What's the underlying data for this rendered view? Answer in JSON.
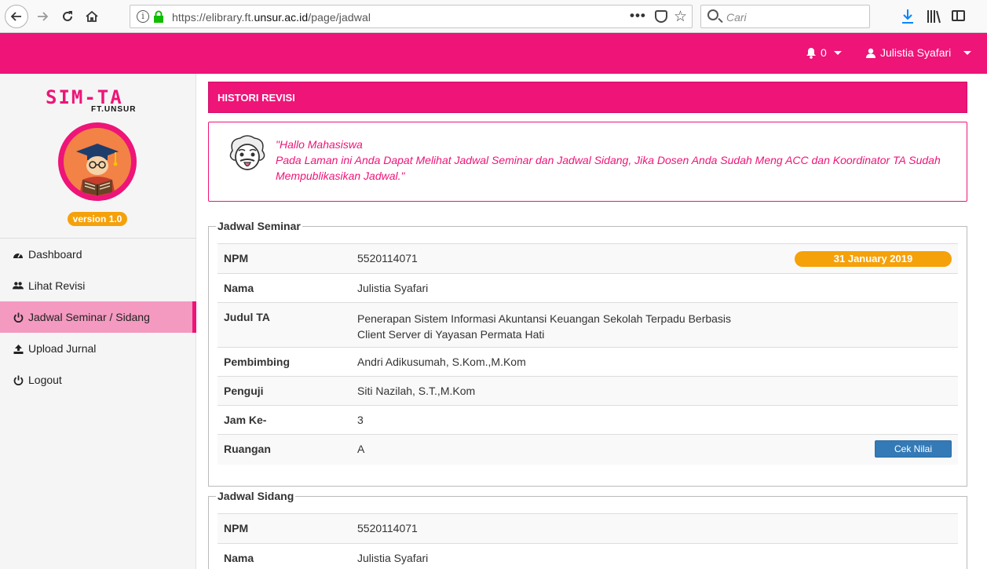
{
  "browser": {
    "url_prefix": "https://elibrary.ft.",
    "url_domain": "unsur.ac.id",
    "url_path": "/page/jadwal",
    "search_placeholder": "Cari",
    "more_label": "•••"
  },
  "header": {
    "notification_count": "0",
    "user_name": "Julistia Syafari"
  },
  "sidebar": {
    "logo_text": "SIM-TA",
    "logo_sub": "FT.UNSUR",
    "version": "version 1.0",
    "items": [
      {
        "label": "Dashboard",
        "icon": "dashboard-icon",
        "active": false
      },
      {
        "label": "Lihat Revisi",
        "icon": "users-icon",
        "active": false
      },
      {
        "label": "Jadwal Seminar / Sidang",
        "icon": "power-icon",
        "active": true
      },
      {
        "label": "Upload Jurnal",
        "icon": "upload-icon",
        "active": false
      },
      {
        "label": "Logout",
        "icon": "power-icon",
        "active": false
      }
    ]
  },
  "main": {
    "panel_title": "HISTORI REVISI",
    "alert_line1": "\"Hallo Mahasiswa",
    "alert_line2": "Pada Laman ini Anda Dapat Melihat Jadwal Seminar dan Jadwal Sidang, Jika Dosen Anda Sudah Meng ACC dan Koordinator TA Sudah Mempublikasikan Jadwal.\"",
    "seminar": {
      "legend": "Jadwal Seminar",
      "date": "31 January 2019",
      "button": "Cek Nilai",
      "rows": [
        {
          "label": "NPM",
          "value": "5520114071"
        },
        {
          "label": "Nama",
          "value": "Julistia Syafari"
        },
        {
          "label": "Judul TA",
          "value": "Penerapan Sistem Informasi Akuntansi Keuangan Sekolah Terpadu Berbasis",
          "value2": "Client Server di Yayasan Permata Hati"
        },
        {
          "label": "Pembimbing",
          "value": "Andri Adikusumah, S.Kom.,M.Kom"
        },
        {
          "label": "Penguji",
          "value": "Siti Nazilah, S.T.,M.Kom"
        },
        {
          "label": "Jam Ke-",
          "value": "3"
        },
        {
          "label": "Ruangan",
          "value": "A"
        }
      ]
    },
    "sidang": {
      "legend": "Jadwal Sidang",
      "rows": [
        {
          "label": "NPM",
          "value": "5520114071"
        },
        {
          "label": "Nama",
          "value": "Julistia Syafari"
        }
      ]
    }
  }
}
